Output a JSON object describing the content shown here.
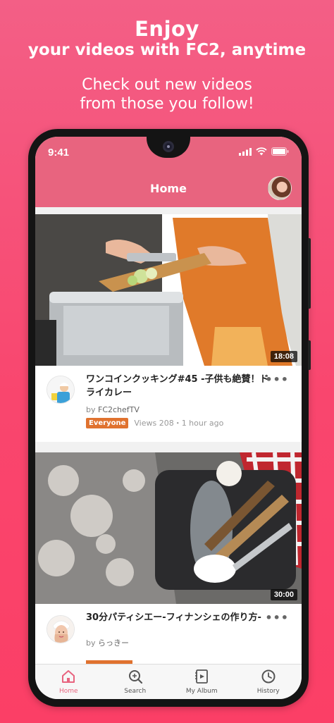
{
  "promo": {
    "line1": "Enjoy",
    "line2": "your videos with FC2, anytime",
    "line3": "Check out new videos",
    "line4": "from those you follow!"
  },
  "status_bar": {
    "time": "9:41"
  },
  "app_bar": {
    "title": "Home"
  },
  "videos": [
    {
      "title": "ワンコインクッキング#45 -子供も絶賛！ドライカレー",
      "duration": "18:08",
      "by_prefix": "by",
      "channel": "FC2chefTV",
      "rating_badge": "Everyone",
      "views": "Views 208",
      "separator": "・",
      "posted": "1 hour ago"
    },
    {
      "title": "30分パティシエー-フィナンシェの作り方-",
      "duration": "30:00",
      "by_prefix": "by",
      "channel": "らっきー"
    }
  ],
  "tabs": [
    {
      "label": "Home",
      "icon": "home-icon",
      "active": true
    },
    {
      "label": "Search",
      "icon": "search-icon",
      "active": false
    },
    {
      "label": "My Album",
      "icon": "album-icon",
      "active": false
    },
    {
      "label": "History",
      "icon": "history-icon",
      "active": false
    }
  ],
  "colors": {
    "brand": "#e8647f",
    "background": "#f9466e",
    "badge": "#e0722f"
  }
}
